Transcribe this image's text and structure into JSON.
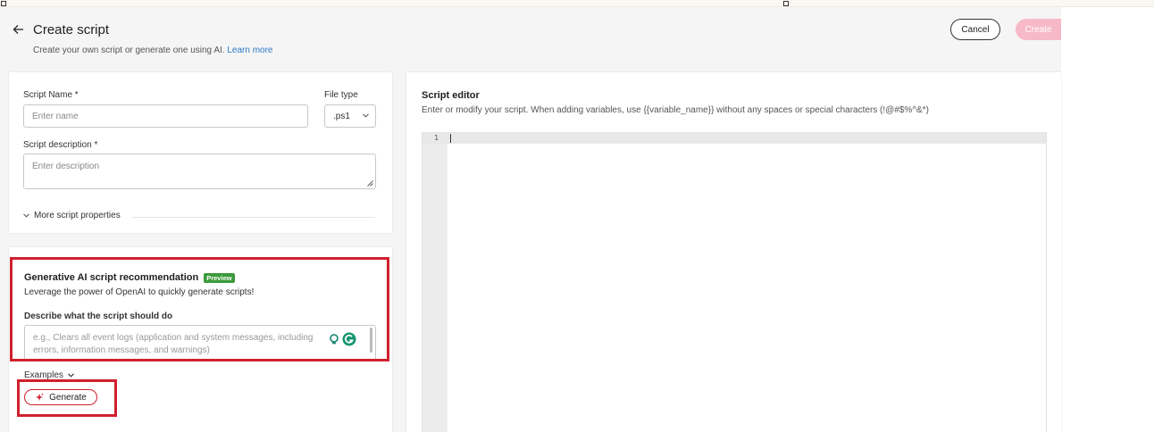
{
  "header": {
    "title": "Create script",
    "subtitle": "Create your own script or generate one using AI.",
    "learn_more": "Learn more",
    "cancel_label": "Cancel",
    "create_label": "Create"
  },
  "properties": {
    "script_name_label": "Script Name *",
    "script_name_placeholder": "Enter name",
    "file_type_label": "File type",
    "file_type_value": ".ps1",
    "description_label": "Script description *",
    "description_placeholder": "Enter description",
    "more_properties": "More script properties"
  },
  "ai": {
    "title": "Generative AI script recommendation",
    "badge": "Preview",
    "description": "Leverage the power of OpenAI to quickly generate scripts!",
    "prompt_label": "Describe what the script should do",
    "prompt_placeholder": "e.g., Clears all event logs (application and system messages, including errors, information messages, and warnings)",
    "examples_label": "Examples",
    "generate_label": "Generate"
  },
  "editor": {
    "title": "Script editor",
    "description": "Enter or modify your script. When adding variables, use {{variable_name}} without any spaces or special characters (!@#$%^&*)",
    "line_number": "1"
  },
  "colors": {
    "accent": "#d0202e",
    "create_disabled": "#f7b9c8",
    "link": "#2a7ac2",
    "preview_badge": "#3d9a3b",
    "annotation_box": "#d0202e"
  },
  "icons": [
    "back-arrow-icon",
    "chevron-down-icon",
    "sparkle-icon",
    "lightbulb-icon",
    "grammarly-icon",
    "resize-grip-icon"
  ]
}
